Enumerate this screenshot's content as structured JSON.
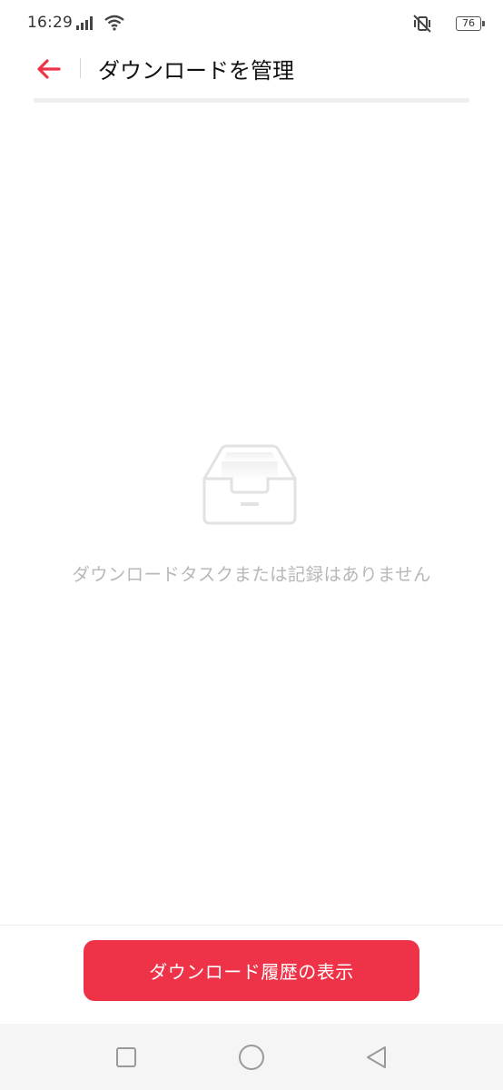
{
  "status_bar": {
    "time": "16:29",
    "battery_level": "76",
    "icons": [
      "signal-icon",
      "wifi-icon",
      "vibrate-silent-icon",
      "battery-icon"
    ]
  },
  "header": {
    "title": "ダウンロードを管理",
    "back_icon": "back-arrow-icon",
    "accent_color": "#ee3348"
  },
  "empty_state": {
    "icon": "empty-tray-icon",
    "message": "ダウンロードタスクまたは記録はありません"
  },
  "footer": {
    "history_button_label": "ダウンロード履歴の表示",
    "button_color": "#ee3348"
  },
  "nav_bar": {
    "buttons": [
      "recent-apps-icon",
      "home-icon",
      "back-icon"
    ]
  }
}
